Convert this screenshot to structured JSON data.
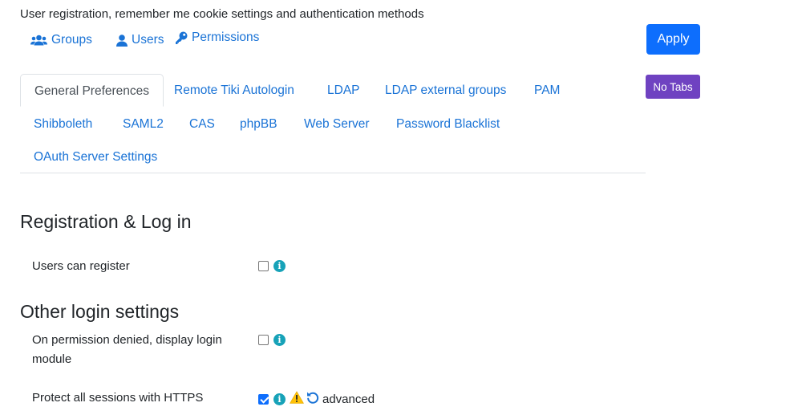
{
  "description": "User registration, remember me cookie settings and authentication methods",
  "quicklinks": {
    "groups": "Groups",
    "users": "Users",
    "permissions": "Permissions"
  },
  "buttons": {
    "apply": "Apply",
    "no_tabs": "No Tabs"
  },
  "tabs": [
    {
      "label": "General Preferences",
      "active": true
    },
    {
      "label": "Remote Tiki Autologin"
    },
    {
      "label": "LDAP"
    },
    {
      "label": "LDAP external groups"
    },
    {
      "label": "PAM"
    },
    {
      "label": "Shibboleth"
    },
    {
      "label": "SAML2"
    },
    {
      "label": "CAS"
    },
    {
      "label": "phpBB"
    },
    {
      "label": "Web Server"
    },
    {
      "label": "Password Blacklist"
    },
    {
      "label": "OAuth Server Settings"
    }
  ],
  "sections": [
    {
      "title": "Registration & Log in",
      "prefs": [
        {
          "label": "Users can register",
          "checked": false
        }
      ]
    },
    {
      "title": "Other login settings",
      "prefs": [
        {
          "label": "On permission denied, display login module",
          "checked": false
        },
        {
          "label": "Protect all sessions with HTTPS",
          "checked": true,
          "tag": "advanced"
        }
      ]
    }
  ],
  "colors": {
    "link": "#1a73d6",
    "apply": "#0d6efd",
    "no_tabs": "#6f42c1",
    "info": "#17a2b8",
    "warning": "#ffc107"
  }
}
